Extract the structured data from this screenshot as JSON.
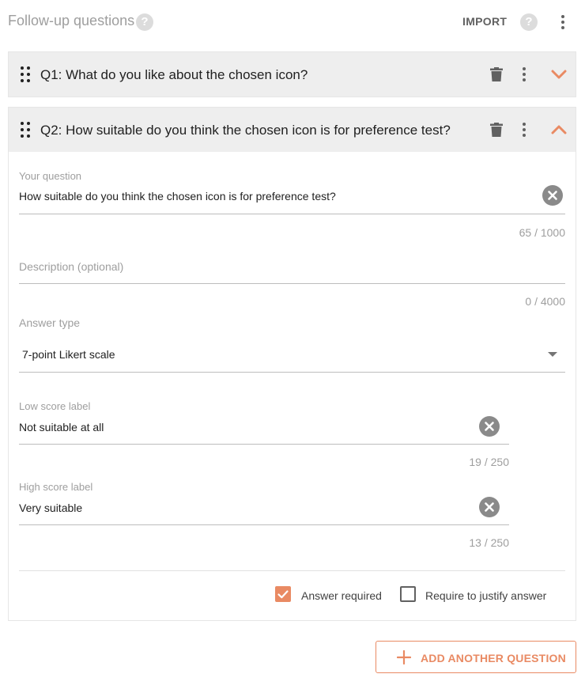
{
  "header": {
    "title": "Follow-up questions",
    "help_glyph": "?",
    "import_label": "IMPORT"
  },
  "questions": [
    {
      "title": "Q1: What do you like about the chosen icon?",
      "expanded": false
    },
    {
      "title": "Q2: How suitable do you think the chosen icon is for preference test?",
      "expanded": true
    }
  ],
  "form": {
    "question": {
      "label": "Your question",
      "value": "How suitable do you think the chosen icon is for preference test?",
      "counter": "65 / 1000"
    },
    "description": {
      "placeholder": "Description (optional)",
      "counter": "0 / 4000"
    },
    "answer_type": {
      "label": "Answer type",
      "value": "7-point Likert scale"
    },
    "low_score": {
      "label": "Low score label",
      "value": "Not suitable at all",
      "counter": "19 / 250"
    },
    "high_score": {
      "label": "High score label",
      "value": "Very suitable",
      "counter": "13 / 250"
    },
    "answer_required": {
      "label": "Answer required",
      "checked": true
    },
    "justify_answer": {
      "label": "Require to justify answer",
      "checked": false
    }
  },
  "add_button": {
    "label": "ADD ANOTHER QUESTION"
  },
  "colors": {
    "accent": "#e98a63",
    "header_bg": "#eeeeee",
    "muted_text": "#9e9e9e"
  },
  "icons": {
    "help": "help-circle-icon",
    "kebab": "more-vertical-icon",
    "drag": "drag-handle-icon",
    "delete": "trash-icon",
    "collapse": "chevron-up-icon",
    "expand": "chevron-down-icon",
    "clear": "clear-circle-icon",
    "dropdown": "caret-down-icon",
    "add": "plus-icon"
  }
}
